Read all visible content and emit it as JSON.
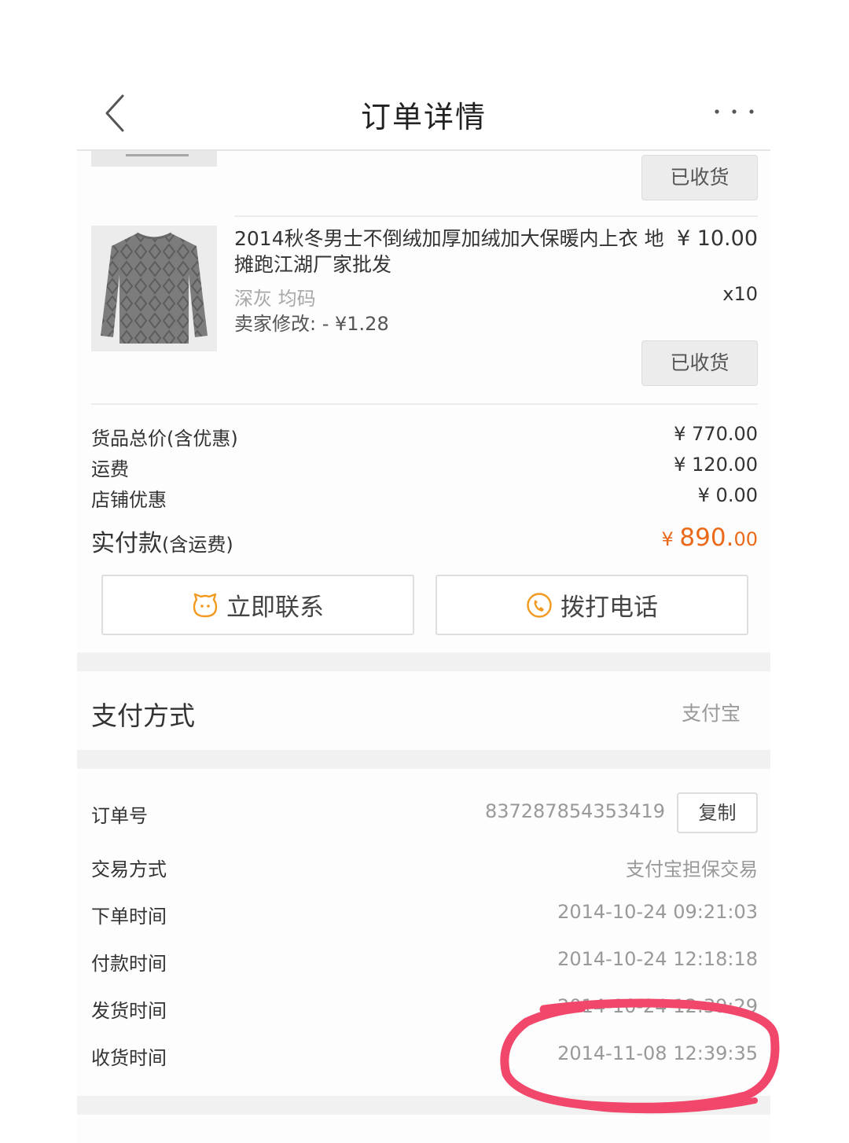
{
  "header": {
    "title": "订单详情"
  },
  "items": [
    {
      "status_label": "已收货"
    },
    {
      "title": "2014秋冬男士不倒绒加厚加绒加大保暖内上衣 地摊跑江湖厂家批发",
      "price": "¥ 10.00",
      "spec": "深灰 均码",
      "quantity": "x10",
      "seller_adjust": "卖家修改: - ¥1.28",
      "status_label": "已收货"
    }
  ],
  "summary": {
    "goods_total_label": "货品总价(含优惠)",
    "goods_total_value": "¥ 770.00",
    "shipping_label": "运费",
    "shipping_value": "¥ 120.00",
    "discount_label": "店铺优惠",
    "discount_value": "¥ 0.00",
    "paid_label": "实付款",
    "paid_note": "(含运费)",
    "paid_currency": "¥ ",
    "paid_integer": "890.",
    "paid_cents": "00"
  },
  "actions": {
    "contact_label": "立即联系",
    "call_label": "拨打电话"
  },
  "payment": {
    "label": "支付方式",
    "value": "支付宝"
  },
  "order_info": {
    "order_no_label": "订单号",
    "order_no_value": "837287854353419",
    "copy_label": "复制",
    "trade_type_label": "交易方式",
    "trade_type_value": "支付宝担保交易",
    "order_time_label": "下单时间",
    "order_time_value": "2014-10-24 09:21:03",
    "pay_time_label": "付款时间",
    "pay_time_value": "2014-10-24 12:18:18",
    "ship_time_label": "发货时间",
    "ship_time_value": "2014-10-24 12:39:29",
    "receive_time_label": "收货时间",
    "receive_time_value": "2014-11-08 12:39:35"
  },
  "colors": {
    "accent_orange": "#ea6a1a",
    "annotation_red": "#f0476b"
  }
}
